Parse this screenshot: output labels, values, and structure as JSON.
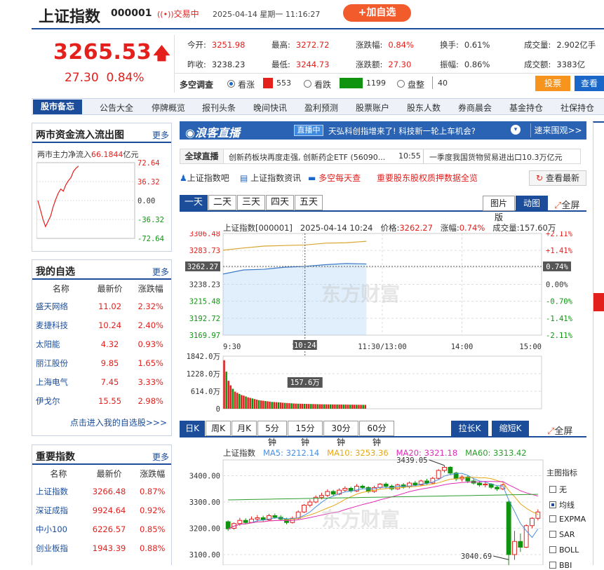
{
  "header": {
    "title": "上证指数",
    "code": "000001",
    "status": "交易中",
    "datetime": "2025-04-14 星期一 11:16:27",
    "add_button": "+加自选"
  },
  "quote": {
    "price": "3265.53",
    "change": "27.30",
    "change_pct": "0.84%",
    "fields": [
      {
        "label": "今开:",
        "value": "3251.98"
      },
      {
        "label": "最高:",
        "value": "3272.72"
      },
      {
        "label": "涨跌幅:",
        "value": "0.84%"
      },
      {
        "label": "换手:",
        "value": "0.61%"
      },
      {
        "label": "成交量:",
        "value": "2.902亿手"
      },
      {
        "label": "昨收:",
        "value": "3238.23"
      },
      {
        "label": "最低:",
        "value": "3244.73"
      },
      {
        "label": "涨跌额:",
        "value": "27.30"
      },
      {
        "label": "振幅:",
        "value": "0.86%"
      },
      {
        "label": "成交额:",
        "value": "3383亿"
      }
    ]
  },
  "survey": {
    "label": "多空调查",
    "bull_label": "看涨",
    "bull_count": "553",
    "bear_label": "看跌",
    "bear_count": "1199",
    "flat_label": "盘整",
    "flat_count": "40",
    "vote_button": "投票",
    "view_button": "查看"
  },
  "nav": {
    "first": "股市备忘",
    "items": [
      "公告大全",
      "停牌概览",
      "报刊头条",
      "晚间快讯",
      "盈利预测",
      "股票账户",
      "股东人数",
      "券商晨会",
      "基金持仓",
      "社保持仓"
    ]
  },
  "flow_panel": {
    "title": "两市资金流入流出图",
    "more": "更多",
    "label": "两市主力净流入",
    "value": "66.1844",
    "unit": "亿元",
    "y_labels": [
      "72.64",
      "36.32",
      "0.00",
      "-36.32",
      "-72.64"
    ],
    "series": [
      0,
      -18,
      -36,
      -50,
      -40,
      -30,
      -12,
      2,
      14,
      22,
      18,
      30,
      38,
      44,
      56,
      62,
      66.18
    ]
  },
  "watchlist": {
    "title": "我的自选",
    "more": "更多",
    "headers": [
      "名称",
      "最新价",
      "涨跌幅"
    ],
    "rows": [
      {
        "name": "盛天网络",
        "price": "11.02",
        "pct": "2.32%"
      },
      {
        "name": "麦捷科技",
        "price": "10.24",
        "pct": "2.40%"
      },
      {
        "name": "太阳能",
        "price": "4.32",
        "pct": "0.93%"
      },
      {
        "name": "丽江股份",
        "price": "9.85",
        "pct": "1.65%"
      },
      {
        "name": "上海电气",
        "price": "7.45",
        "pct": "3.33%"
      },
      {
        "name": "伊戈尔",
        "price": "15.55",
        "pct": "2.98%"
      }
    ],
    "link": "点击进入我的自选股>>>"
  },
  "indices": {
    "title": "重要指数",
    "more": "更多",
    "headers": [
      "名称",
      "最新价",
      "涨跌幅"
    ],
    "rows": [
      {
        "name": "上证指数",
        "price": "3266.48",
        "pct": "0.87%"
      },
      {
        "name": "深证成指",
        "price": "9924.64",
        "pct": "0.92%"
      },
      {
        "name": "中小100",
        "price": "6226.57",
        "pct": "0.85%"
      },
      {
        "name": "创业板指",
        "price": "1943.39",
        "pct": "0.88%"
      }
    ]
  },
  "langke": {
    "logo": "浪客直播",
    "live": "直播中",
    "text": "天弘科创指增来了! 科技新一轮上车机会?",
    "enter": "速来围观>>"
  },
  "global_bar": {
    "tag": "全球直播",
    "news1": "创新药板块再度走强, 创新药企ETF (56090...",
    "news1_time": "10:55",
    "news2": "一季度我国货物贸易进出口10.3万亿元"
  },
  "links": {
    "forum": "上证指数吧",
    "info": "上证指数资讯",
    "daily": "多空每天查",
    "pledge": "重要股东股权质押数据全览",
    "refresh": "查看最新"
  },
  "period_tabs": [
    "一天",
    "二天",
    "三天",
    "四天",
    "五天"
  ],
  "view_tabs": {
    "pic": "图片版",
    "dyn": "动图版",
    "full": "全屏"
  },
  "intraday": {
    "info": {
      "name": "上证指数[000001]",
      "time": "2025-04-14 10:24",
      "price_label": "价格:",
      "price": "3262.27",
      "pct_label": "涨幅:",
      "pct": "0.74%",
      "vol_label": "成交量:",
      "vol": "157.60万"
    },
    "cursor_price": "3262.27",
    "cursor_pct": "0.74%",
    "cursor_time": "10:24",
    "cursor_vol": "157.6万",
    "price_labels": [
      "3306.48",
      "3283.73",
      "3262.27",
      "3238.23",
      "3215.48",
      "3192.72",
      "3169.97"
    ],
    "pct_labels": [
      "+2.11%",
      "+1.41%",
      "0.74%",
      "0.00%",
      "-0.70%",
      "-1.41%",
      "-2.11%"
    ],
    "time_labels": [
      "9:30",
      "10:30",
      "11:30/13:00",
      "14:00",
      "15:00"
    ],
    "vol_labels": [
      "1842.0万",
      "1228.0万",
      "614.0万",
      "0"
    ],
    "watermark": "东方财富"
  },
  "chart_data": [
    {
      "type": "line",
      "title": "上证指数[000001]",
      "x": [
        "9:30",
        "9:45",
        "10:00",
        "10:15",
        "10:24",
        "10:45",
        "11:00",
        "11:16"
      ],
      "series": [
        {
          "name": "价格",
          "values": [
            3251.98,
            3257.5,
            3258.4,
            3261.2,
            3262.27,
            3264.6,
            3266.1,
            3265.53
          ]
        },
        {
          "name": "均价",
          "values": [
            3284.0,
            3287.0,
            3289.5,
            3290.3,
            3291.0,
            3293.5,
            3294.0,
            3296.0
          ]
        }
      ],
      "ylim": [
        3169.97,
        3306.48
      ]
    },
    {
      "type": "bar",
      "title": "成交量",
      "ylim": [
        0,
        1842.0
      ],
      "values": [
        1700,
        1300,
        980,
        820,
        700,
        600,
        560,
        520,
        480,
        460,
        430,
        400,
        380,
        360,
        340,
        320,
        300,
        290,
        280,
        270,
        260,
        250,
        240,
        235,
        230,
        225,
        220,
        210,
        205,
        200,
        195,
        190,
        185,
        180,
        178,
        176,
        174,
        172,
        170,
        168,
        166,
        164,
        162,
        160,
        158,
        156,
        155,
        154,
        153,
        152,
        151,
        150,
        149,
        148,
        147,
        146,
        145,
        144,
        143,
        142,
        141,
        140,
        139,
        138,
        137,
        136
      ]
    },
    {
      "type": "candlestick",
      "title": "上证指数",
      "ylim": [
        3040.69,
        3439.05
      ],
      "high_label": "3439.05",
      "low_label": "3040.69",
      "ma": [
        {
          "name": "MA5",
          "value": "3212.14",
          "color": "#4a8fe0"
        },
        {
          "name": "MA10",
          "value": "3253.36",
          "color": "#e6a817"
        },
        {
          "name": "MA20",
          "value": "3321.18",
          "color": "#e02bb8"
        },
        {
          "name": "MA60",
          "value": "3313.42",
          "color": "#2c9e2c"
        }
      ],
      "candles": [
        [
          3225,
          3198,
          3230,
          3190
        ],
        [
          3200,
          3218,
          3222,
          3195
        ],
        [
          3218,
          3230,
          3240,
          3210
        ],
        [
          3230,
          3222,
          3238,
          3215
        ],
        [
          3222,
          3235,
          3245,
          3220
        ],
        [
          3235,
          3240,
          3250,
          3225
        ],
        [
          3240,
          3232,
          3248,
          3226
        ],
        [
          3232,
          3248,
          3255,
          3228
        ],
        [
          3248,
          3242,
          3256,
          3236
        ],
        [
          3242,
          3235,
          3250,
          3230
        ],
        [
          3235,
          3222,
          3240,
          3215
        ],
        [
          3222,
          3238,
          3245,
          3218
        ],
        [
          3238,
          3262,
          3268,
          3232
        ],
        [
          3262,
          3288,
          3292,
          3258
        ],
        [
          3288,
          3300,
          3310,
          3280
        ],
        [
          3300,
          3318,
          3325,
          3295
        ],
        [
          3318,
          3325,
          3335,
          3310
        ],
        [
          3325,
          3340,
          3348,
          3318
        ],
        [
          3340,
          3330,
          3346,
          3322
        ],
        [
          3330,
          3345,
          3352,
          3326
        ],
        [
          3345,
          3352,
          3360,
          3338
        ],
        [
          3352,
          3342,
          3358,
          3336
        ],
        [
          3342,
          3360,
          3368,
          3338
        ],
        [
          3360,
          3355,
          3366,
          3348
        ],
        [
          3355,
          3340,
          3360,
          3334
        ],
        [
          3340,
          3355,
          3362,
          3335
        ],
        [
          3355,
          3368,
          3372,
          3350
        ],
        [
          3368,
          3360,
          3375,
          3352
        ],
        [
          3360,
          3350,
          3366,
          3344
        ],
        [
          3350,
          3365,
          3370,
          3346
        ],
        [
          3365,
          3358,
          3372,
          3350
        ],
        [
          3358,
          3372,
          3378,
          3352
        ],
        [
          3372,
          3365,
          3380,
          3360
        ],
        [
          3365,
          3380,
          3385,
          3360
        ],
        [
          3380,
          3372,
          3388,
          3366
        ],
        [
          3372,
          3390,
          3396,
          3368
        ],
        [
          3390,
          3420,
          3425,
          3385
        ],
        [
          3420,
          3432,
          3439.05,
          3412
        ],
        [
          3432,
          3410,
          3436,
          3402
        ],
        [
          3410,
          3388,
          3415,
          3380
        ],
        [
          3388,
          3395,
          3402,
          3378
        ],
        [
          3395,
          3380,
          3400,
          3372
        ],
        [
          3380,
          3372,
          3388,
          3366
        ],
        [
          3372,
          3365,
          3380,
          3358
        ],
        [
          3365,
          3368,
          3378,
          3356
        ],
        [
          3368,
          3356,
          3372,
          3350
        ],
        [
          3356,
          3350,
          3362,
          3342
        ],
        [
          3350,
          3365,
          3370,
          3345
        ],
        [
          3300,
          3100,
          3305,
          3040.69
        ],
        [
          3100,
          3150,
          3190,
          3080
        ],
        [
          3150,
          3128,
          3180,
          3110
        ],
        [
          3128,
          3210,
          3215,
          3125
        ],
        [
          3210,
          3238,
          3242,
          3200
        ],
        [
          3238,
          3262,
          3272,
          3230
        ]
      ]
    }
  ],
  "kline_tabs": [
    "日K",
    "周K",
    "月K",
    "5分钟",
    "15分钟",
    "30分钟",
    "60分钟"
  ],
  "kline_buttons": {
    "long": "拉长K线",
    "short": "缩短K线",
    "full": "全屏"
  },
  "kline": {
    "price_labels": [
      "3400.00",
      "3300.00",
      "3200.00",
      "3100.00"
    ]
  },
  "indicator_panel": {
    "title": "主图指标",
    "options": [
      "无",
      "均线",
      "EXPMA",
      "SAR",
      "BOLL",
      "BBI"
    ],
    "selected": "均线"
  },
  "colors": {
    "up": "#e4201d",
    "down": "#109410",
    "brand": "#1b4d9a",
    "accent": "#f25b2c"
  }
}
